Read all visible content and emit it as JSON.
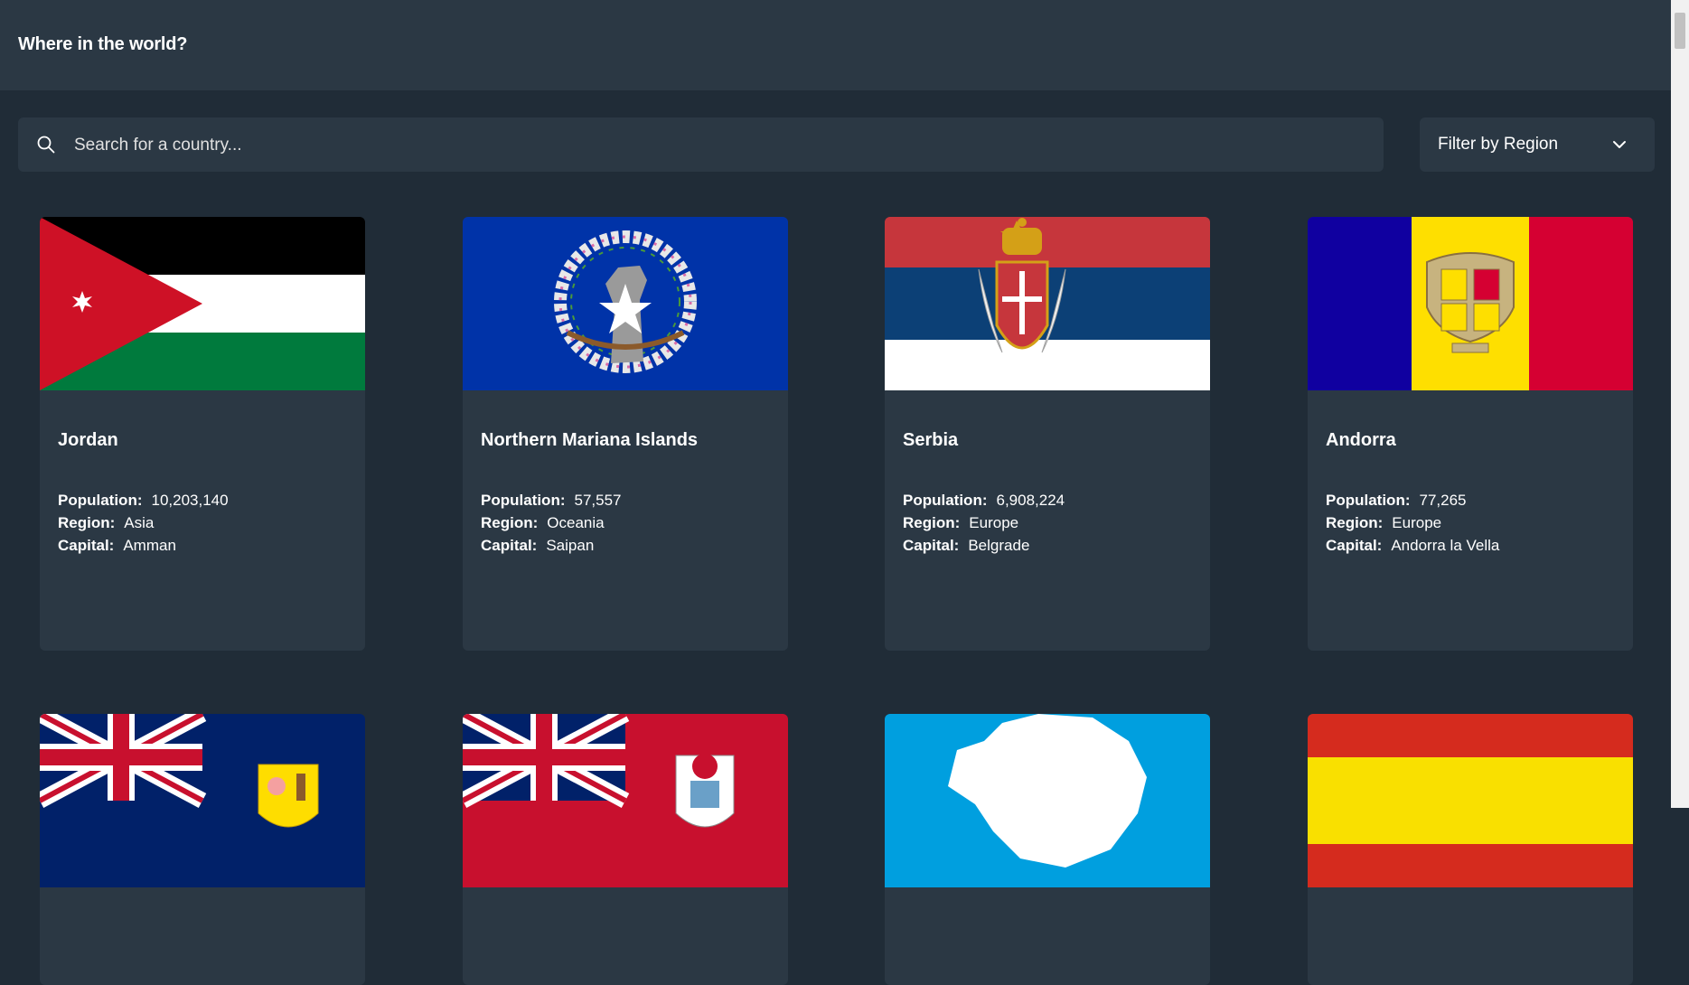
{
  "header": {
    "title": "Where in the world?"
  },
  "search": {
    "placeholder": "Search for a country..."
  },
  "filter": {
    "label": "Filter by Region"
  },
  "labels": {
    "population": "Population:",
    "region": "Region:",
    "capital": "Capital:"
  },
  "countries": [
    {
      "name": "Jordan",
      "population": "10,203,140",
      "region": "Asia",
      "capital": "Amman"
    },
    {
      "name": "Northern Mariana Islands",
      "population": "57,557",
      "region": "Oceania",
      "capital": "Saipan"
    },
    {
      "name": "Serbia",
      "population": "6,908,224",
      "region": "Europe",
      "capital": "Belgrade"
    },
    {
      "name": "Andorra",
      "population": "77,265",
      "region": "Europe",
      "capital": "Andorra la Vella"
    }
  ],
  "flags_row2": [
    "Turks and Caicos Islands flag",
    "Bermuda flag",
    "Antarctica flag",
    "Spain flag"
  ],
  "colors": {
    "background": "#202c37",
    "surface": "#2b3844",
    "text": "#ffffff"
  }
}
